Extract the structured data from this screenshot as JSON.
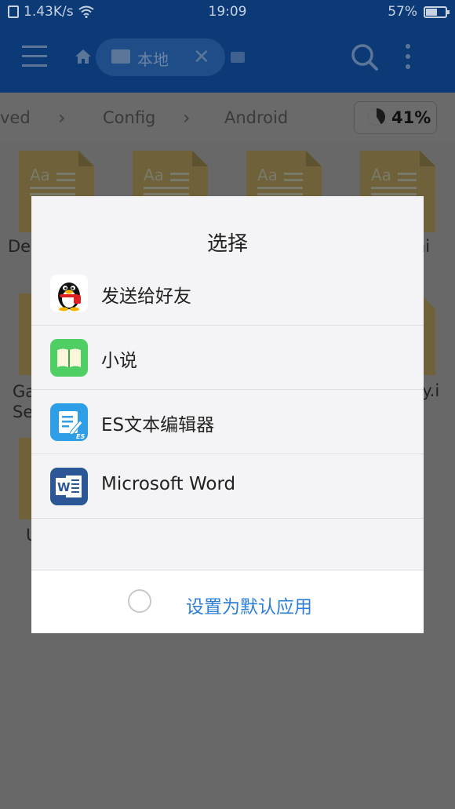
{
  "status_bar": {
    "network_speed": "1.43K/s",
    "time": "19:09",
    "battery": "57%",
    "battery_level": 0.57
  },
  "app_bar": {
    "location_label": "本地"
  },
  "breadcrumb": {
    "items": [
      "ved",
      "Config",
      "Android"
    ],
    "storage_percent": "41%",
    "storage_used_fraction": 0.41
  },
  "background_files": [
    {
      "label": "De"
    },
    {
      "label": ""
    },
    {
      "label": ""
    },
    {
      "label": "hi"
    },
    {
      "label": "Ga\nSe"
    },
    {
      "label": "ty.i"
    },
    {
      "label": "U"
    }
  ],
  "dialog": {
    "title": "选择",
    "apps": [
      {
        "label": "发送给好友",
        "icon": "qq-penguin-icon"
      },
      {
        "label": "小说",
        "icon": "novel-book-icon"
      },
      {
        "label": "ES文本编辑器",
        "icon": "es-text-editor-icon"
      },
      {
        "label": "Microsoft Word",
        "icon": "microsoft-word-icon"
      }
    ],
    "default_label": "设置为默认应用"
  },
  "colors": {
    "app_bar": "#0c3a76",
    "dim_overlay": "#686868",
    "link_blue": "#2d7fd7"
  }
}
